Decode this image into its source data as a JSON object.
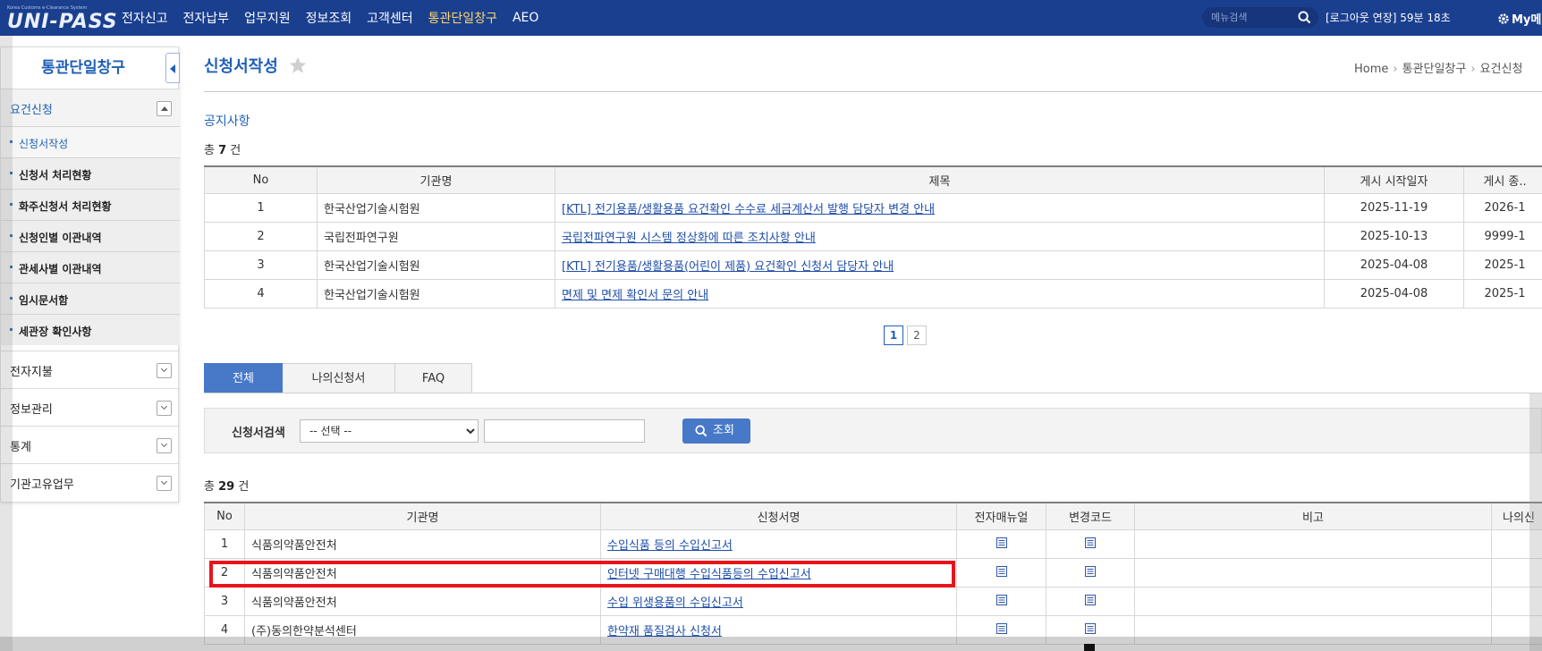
{
  "header": {
    "logo_sub": "Korea Customs e-Clearance System",
    "logo": "UNI-PASS",
    "nav": [
      "전자신고",
      "전자납부",
      "업무지원",
      "정보조회",
      "고객센터",
      "통관단일창구",
      "AEO"
    ],
    "menu_search_placeholder": "메뉴검색",
    "login_extend": "[로그아웃 연장] 59분 18초",
    "mymenu": "My메"
  },
  "sidebar": {
    "title": "통관단일창구",
    "groups": [
      {
        "label": "요건신청"
      },
      {
        "label": "전자지불"
      },
      {
        "label": "정보관리"
      },
      {
        "label": "통계"
      },
      {
        "label": "기관고유업무"
      }
    ],
    "sub_items": [
      "신청서작성",
      "신청서 처리현황",
      "화주신청서 처리현황",
      "신청인별 이관내역",
      "관세사별 이관내역",
      "임시문서함",
      "세관장 확인사항"
    ]
  },
  "page": {
    "title": "신청서작성",
    "breadcrumb": [
      "Home",
      "통관단일창구",
      "요건신청"
    ]
  },
  "notice": {
    "heading": "공지사항",
    "count_prefix": "총",
    "count": "7",
    "count_suffix": "건",
    "columns": [
      "No",
      "기관명",
      "제목",
      "게시 시작일자",
      "게시 종.."
    ],
    "rows": [
      {
        "no": "1",
        "org": "한국산업기술시험원",
        "title": "[KTL] 전기용품/생활용품 요건확인 수수료 세금계산서 발행 담당자 변경 안내",
        "start": "2025-11-19",
        "end": "2026-1"
      },
      {
        "no": "2",
        "org": "국립전파연구원",
        "title": "국립전파연구원 시스템 정상화에 따른 조치사항 안내",
        "start": "2025-10-13",
        "end": "9999-1"
      },
      {
        "no": "3",
        "org": "한국산업기술시험원",
        "title": "[KTL] 전기용품/생활용품(어린이 제품) 요건확인 신청서 담당자 안내",
        "start": "2025-04-08",
        "end": "2025-1"
      },
      {
        "no": "4",
        "org": "한국산업기술시험원",
        "title": "면제 및 면제 확인서 문의 안내",
        "start": "2025-04-08",
        "end": "2025-1"
      }
    ],
    "pages": [
      "1",
      "2"
    ]
  },
  "tabs": [
    "전체",
    "나의신청서",
    "FAQ"
  ],
  "search": {
    "label": "신청서검색",
    "select_value": "-- 선택 --",
    "button": "조회"
  },
  "forms": {
    "count_prefix": "총",
    "count": "29",
    "count_suffix": "건",
    "columns": [
      "No",
      "기관명",
      "신청서명",
      "전자매뉴얼",
      "변경코드",
      "비고",
      "나의신"
    ],
    "rows": [
      {
        "no": "1",
        "org": "식품의약품안전처",
        "name": "수입식품 등의 수입신고서"
      },
      {
        "no": "2",
        "org": "식품의약품안전처",
        "name": "인터넷 구매대행 수입식품등의 수입신고서"
      },
      {
        "no": "3",
        "org": "식품의약품안전처",
        "name": "수입 위생용품의 수입신고서"
      },
      {
        "no": "4",
        "org": "(주)동의한약분석센터",
        "name": "한약재 품질검사 신청서"
      }
    ]
  },
  "colors": {
    "brand": "#1b3f8f",
    "accent": "#4878c8",
    "highlight": "#e8141c"
  }
}
